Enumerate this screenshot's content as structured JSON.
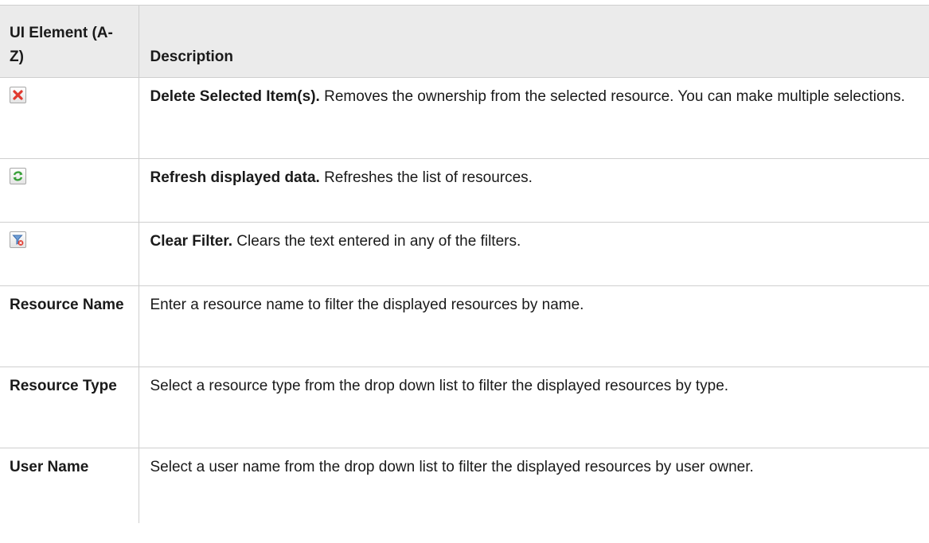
{
  "header": {
    "col1": "UI Element (A-Z)",
    "col2": "Description"
  },
  "rows": [
    {
      "icon": "delete-icon",
      "title": "Delete Selected Item(s).",
      "description": " Removes the ownership from the selected resource. You can make multiple selections."
    },
    {
      "icon": "refresh-icon",
      "title": "Refresh displayed data.",
      "description": " Refreshes the list of resources."
    },
    {
      "icon": "clear-filter-icon",
      "title": "Clear Filter.",
      "description": " Clears the text entered in any of the filters."
    },
    {
      "element": "Resource Name",
      "description": "Enter a resource name to filter the displayed resources by name."
    },
    {
      "element": "Resource Type",
      "description": "Select a resource type from the drop down list to filter the displayed resources by type."
    },
    {
      "element": "User Name",
      "description": "Select a user name from the drop down list to filter the displayed resources by user owner."
    }
  ],
  "colors": {
    "header_bg": "#ebebeb",
    "border": "#cfcfcf",
    "delete_icon": "#e03a2f",
    "refresh_icon": "#3aa03a",
    "filter_icon": "#4a7fbf"
  }
}
